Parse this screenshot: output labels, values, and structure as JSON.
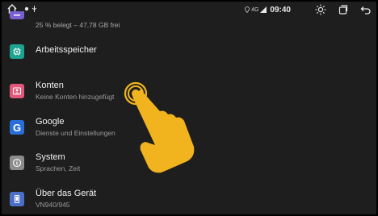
{
  "colors": {
    "storage": "#7a5fd1",
    "memory": "#1fa391",
    "accounts": "#e2577a",
    "google": "#2a6fd9",
    "system": "#8c8c8c",
    "device": "#4b70c9",
    "hand": "#f1b41e"
  },
  "status": {
    "time": "09:40",
    "signal": "4G",
    "home_icon": "home-icon",
    "icons": [
      "sun-brightness-icon",
      "recent-apps-icon",
      "back-icon"
    ]
  },
  "storage": {
    "summary": "25 % belegt – 47,78 GB frei"
  },
  "items": [
    {
      "title": "Arbeitsspeicher",
      "subtitle": "",
      "icon": "memory-chip-icon"
    },
    {
      "title": "Konten",
      "subtitle": "Keine Konten hinzugefügt",
      "icon": "account-card-icon"
    },
    {
      "title": "Google",
      "subtitle": "Dienste und Einstellungen",
      "icon": "google-icon",
      "icon_text": "G"
    },
    {
      "title": "System",
      "subtitle": "Sprachen, Zeit",
      "icon": "info-icon"
    },
    {
      "title": "Über das Gerät",
      "subtitle": "VN940/945",
      "icon": "phone-device-icon"
    }
  ],
  "overlay": {
    "icon": "tap-hand-gesture-icon"
  }
}
